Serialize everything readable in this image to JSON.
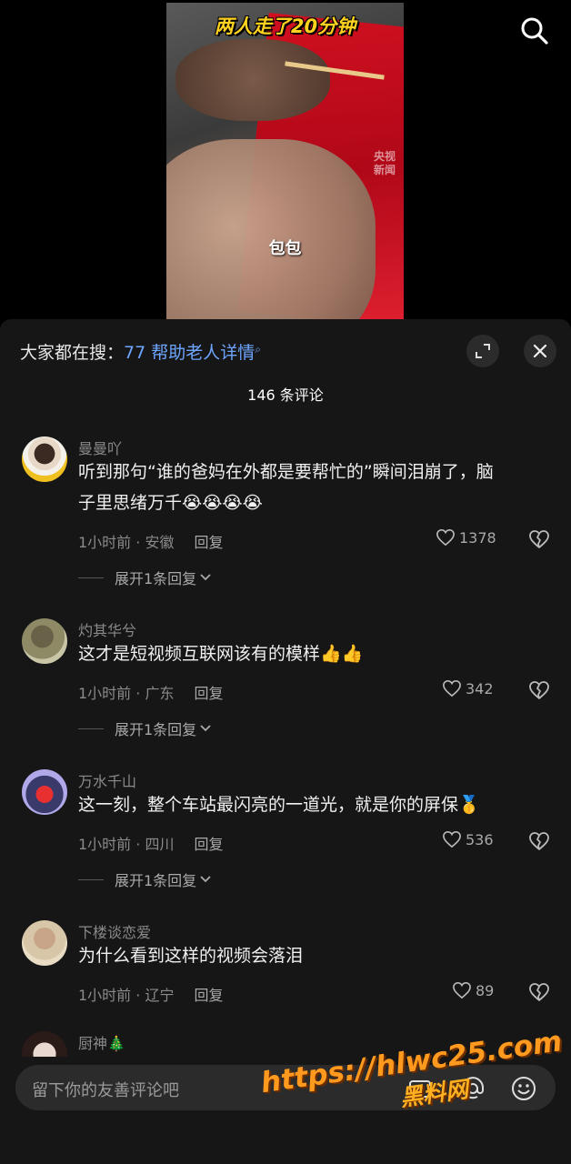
{
  "video": {
    "title_overlay": "两人走了20分钟",
    "subtitle": "包包",
    "corner_mark": "央视\n新闻"
  },
  "header": {
    "trending_prefix": "大家都在搜：",
    "trending_topic": "77 帮助老人详情",
    "comment_count": "146 条评论"
  },
  "comments": [
    {
      "username": "曼曼吖",
      "text_line1": "听到那句“谁的爸妈在外都是要帮忙的”瞬间泪崩了，脑",
      "text_line2": "子里思绪万千",
      "emoji": "😭😭😭😭",
      "time_location": "1小时前 · 安徽",
      "reply_label": "回复",
      "likes": "1378",
      "expand_label": "展开1条回复"
    },
    {
      "username": "灼其华兮",
      "text_line1": "这才是短视频互联网该有的模样",
      "emoji": "👍👍",
      "time_location": "1小时前 · 广东",
      "reply_label": "回复",
      "likes": "342",
      "expand_label": "展开1条回复"
    },
    {
      "username": "万水千山",
      "text_line1": "这一刻，整个车站最闪亮的一道光，就是你的屏保",
      "emoji": "🥇",
      "time_location": "1小时前 · 四川",
      "reply_label": "回复",
      "likes": "536",
      "expand_label": "展开1条回复"
    },
    {
      "username": "下楼谈恋爱",
      "text_line1": "为什么看到这样的视频会落泪",
      "time_location": "1小时前 · 辽宁",
      "reply_label": "回复",
      "likes": "89"
    },
    {
      "username": "厨神",
      "username_emoji": "🎄"
    }
  ],
  "input": {
    "placeholder": "留下你的友善评论吧"
  },
  "watermark": {
    "url": "https://hlwc25.com",
    "site_name": "黑料网"
  },
  "colors": {
    "accent_link": "#6ea5ff",
    "sheet_bg": "#161616",
    "watermark": "#ff9a1e"
  }
}
